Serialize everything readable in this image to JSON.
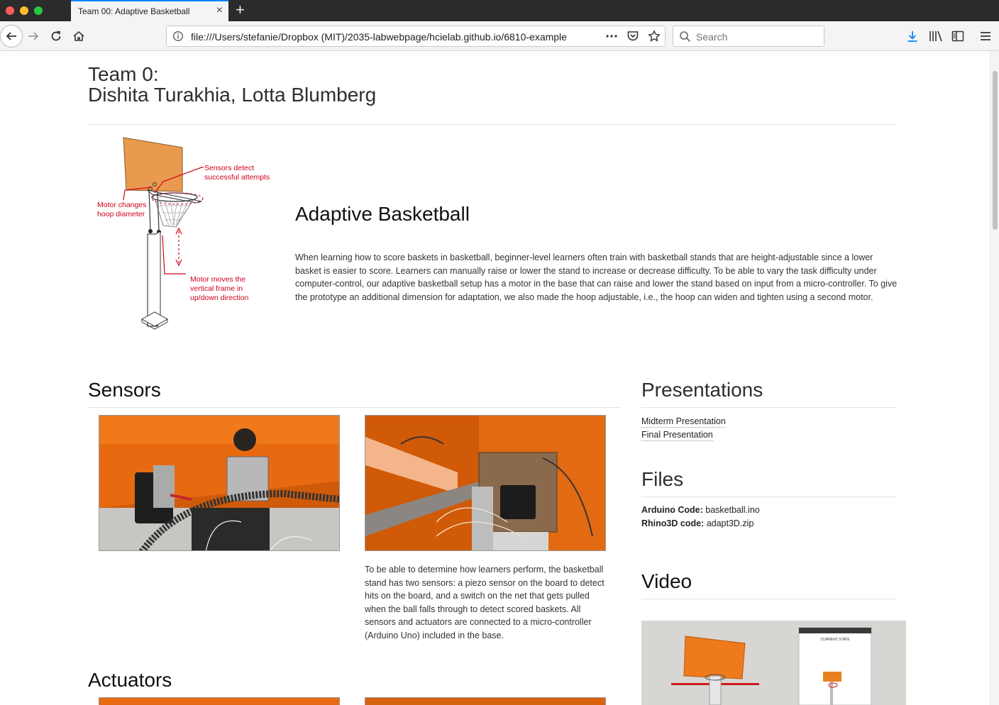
{
  "browser": {
    "tab_title": "Team 00: Adaptive Basketball",
    "tab_close": "×",
    "newtab": "+",
    "url": "file:///Users/stefanie/Dropbox (MIT)/2035-labwebpage/hcielab.github.io/6810-example",
    "search_placeholder": "Search",
    "accent": "#0a84ff"
  },
  "page": {
    "team_line1": "Team 0:",
    "team_line2": "Dishita Turakhia, Lotta Blumberg",
    "diagram": {
      "label_sensors_1": "Sensors detect",
      "label_sensors_2": "successful attempts",
      "label_hoop_1": "Motor changes",
      "label_hoop_2": "hoop diameter",
      "label_frame_1": "Motor moves the",
      "label_frame_2": "vertical frame in",
      "label_frame_3": "up/down direction",
      "label_color": "#d0021b"
    },
    "project_title": "Adaptive Basketball",
    "project_description": "When learning how to score baskets in basketball, beginner-level learners often train with basketball stands that are height-adjustable since a lower basket is easier to score. Learners can manually raise or lower the stand to increase or decrease difficulty. To be able to vary the task difficulty under computer-control, our adaptive basketball setup has a motor in the base that can raise and lower the stand based on input from a micro-controller. To give the prototype an additional dimension for adaptation, we also made the hoop adjustable, i.e., the hoop can widen and tighten using a second motor.",
    "sensors_heading": "Sensors",
    "sensors_text": "To be able to determine how learners perform, the basketball stand has two sensors: a piezo sensor on the board to detect hits on the board, and a switch on the net that gets pulled when the ball falls through to detect scored baskets. All sensors and actuators are connected to a micro-controller (Arduino Uno) included in the base.",
    "actuators_heading": "Actuators",
    "presentations_heading": "Presentations",
    "presentations": [
      "Midterm Presentation",
      "Final Presentation"
    ],
    "files_heading": "Files",
    "files": [
      {
        "label": "Arduino Code:",
        "value": "basketball.ino"
      },
      {
        "label": "Rhino3D code:",
        "value": "adapt3D.zip"
      }
    ],
    "video_heading": "Video",
    "video_screen_title": "CURRENT STATE"
  }
}
